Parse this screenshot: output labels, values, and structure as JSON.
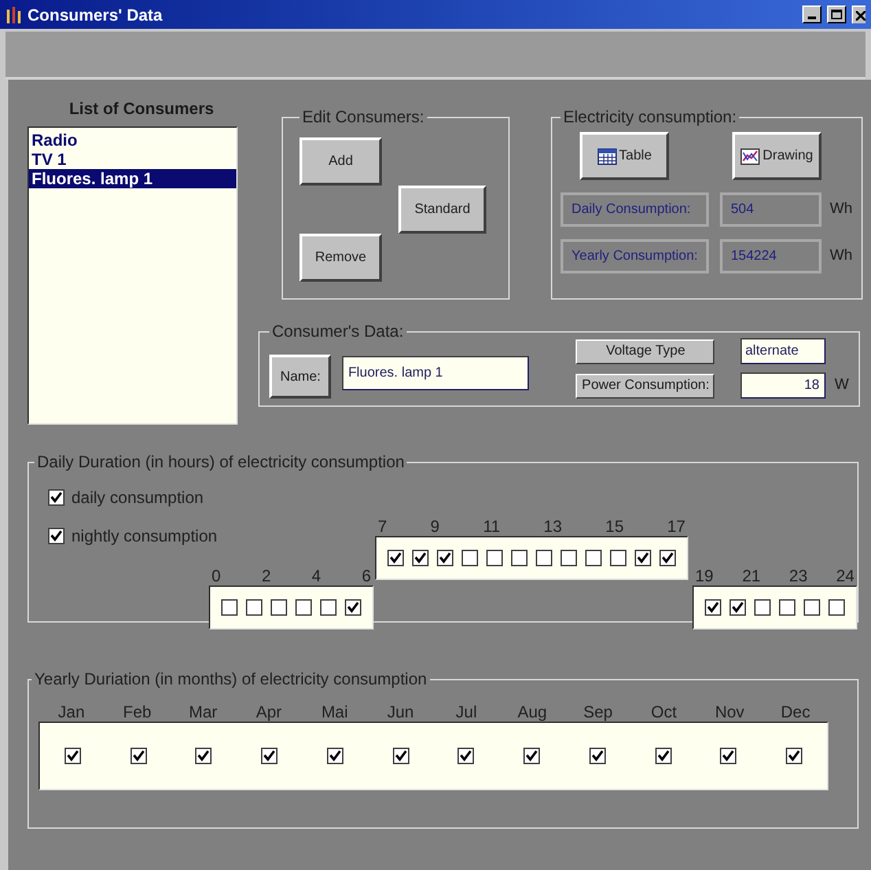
{
  "window": {
    "title": "Consumers' Data"
  },
  "consumer_list": {
    "title": "List of Consumers",
    "items": [
      {
        "label": "Radio",
        "selected": false
      },
      {
        "label": "TV 1",
        "selected": false
      },
      {
        "label": "Fluores. lamp 1",
        "selected": true
      }
    ]
  },
  "edit_consumers": {
    "title": "Edit Consumers:",
    "buttons": [
      "Add",
      "Standard",
      "Remove"
    ]
  },
  "electricity": {
    "title": "Electricity consumption:",
    "buttons": [
      {
        "label": "Table",
        "kind": "table"
      },
      {
        "label": "Drawing",
        "kind": "drawing"
      }
    ],
    "readings": [
      {
        "label": "Daily  Consumption:",
        "value": "504",
        "unit": "Wh"
      },
      {
        "label": "Yearly Consumption:",
        "value": "154224",
        "unit": "Wh"
      }
    ]
  },
  "consumer_data": {
    "title": "Consumer's Data:",
    "name_label": "Name:",
    "name_value": "Fluores. lamp 1",
    "voltage_label": "Voltage Type",
    "voltage_value": "alternate",
    "power_label": "Power Consumption:",
    "power_value": "18",
    "power_unit": "W"
  },
  "daily": {
    "title": "Daily Duration (in hours) of electricity consumption",
    "options": [
      {
        "label": "daily consumption",
        "checked": true
      },
      {
        "label": "nightly consumption",
        "checked": true
      }
    ],
    "blocks": [
      {
        "labels": [
          "0",
          "2",
          "4",
          "6"
        ],
        "hours": [
          false,
          false,
          false,
          false,
          false,
          true
        ]
      },
      {
        "labels": [
          "7",
          "9",
          "11",
          "13",
          "15",
          "17"
        ],
        "hours": [
          true,
          true,
          true,
          false,
          false,
          false,
          false,
          false,
          false,
          false,
          true,
          true
        ]
      },
      {
        "labels": [
          "19",
          "21",
          "23",
          "24"
        ],
        "hours": [
          true,
          true,
          false,
          false,
          false,
          false
        ]
      }
    ]
  },
  "yearly": {
    "title": "Yearly Duriation (in months) of electricity consumption",
    "months": [
      {
        "label": "Jan",
        "checked": true
      },
      {
        "label": "Feb",
        "checked": true
      },
      {
        "label": "Mar",
        "checked": true
      },
      {
        "label": "Apr",
        "checked": true
      },
      {
        "label": "Mai",
        "checked": true
      },
      {
        "label": "Jun",
        "checked": true
      },
      {
        "label": "Jul",
        "checked": true
      },
      {
        "label": "Aug",
        "checked": true
      },
      {
        "label": "Sep",
        "checked": true
      },
      {
        "label": "Oct",
        "checked": true
      },
      {
        "label": "Nov",
        "checked": true
      },
      {
        "label": "Dec",
        "checked": true
      }
    ]
  }
}
